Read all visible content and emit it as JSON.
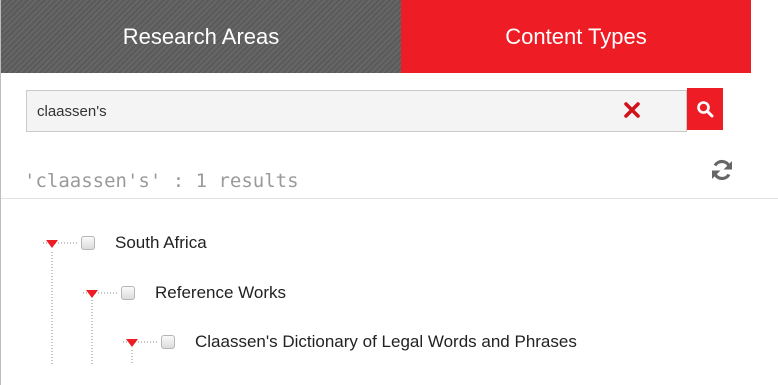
{
  "tabs": [
    {
      "label": "Research Areas",
      "active": false
    },
    {
      "label": "Content Types",
      "active": true
    }
  ],
  "search": {
    "value": "claassen's",
    "clear_icon": "close-icon",
    "search_icon": "search-icon"
  },
  "results": {
    "summary": "'claassen's' : 1 results",
    "refresh_icon": "refresh-icon"
  },
  "tree": {
    "nodes": [
      {
        "label": "South Africa",
        "level": 0,
        "expanded": true,
        "checked": false
      },
      {
        "label": "Reference Works",
        "level": 1,
        "expanded": true,
        "checked": false
      },
      {
        "label": "Claassen's Dictionary of Legal Words and Phrases",
        "level": 2,
        "expanded": true,
        "checked": false
      }
    ]
  },
  "colors": {
    "accent": "#ee1c25",
    "inactive_tab": "#5a5a5a",
    "muted_text": "#9a9a9a"
  }
}
